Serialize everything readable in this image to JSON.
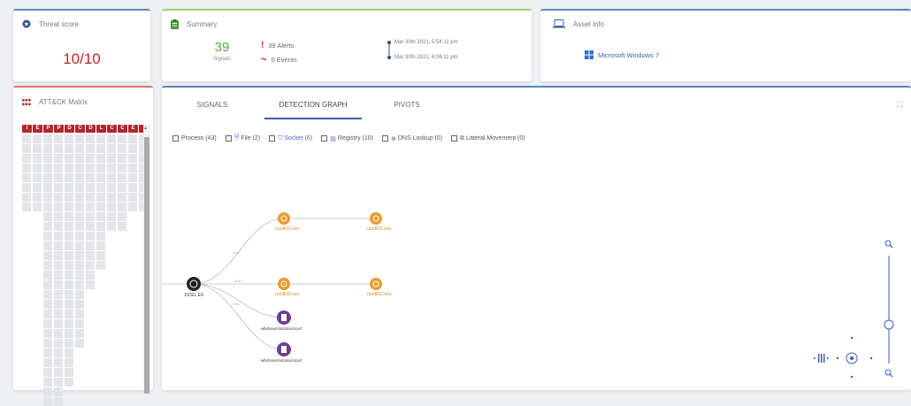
{
  "threat": {
    "title": "Threat score",
    "value": "10/10"
  },
  "summary": {
    "title": "Summary",
    "signals_count": "39",
    "signals_label": "Signals",
    "alerts": "39 Alerts",
    "events": "0 Events",
    "time_start": "Mar 30th 2021, 5:54:11 pm",
    "time_end": "Mar 30th 2021, 6:06:11 pm"
  },
  "asset": {
    "title": "Asset info",
    "os": "Microsoft Windows 7"
  },
  "attack": {
    "title": "ATT&CK Matrix",
    "tactics": [
      "I",
      "E",
      "P",
      "P",
      "D",
      "C",
      "D",
      "L",
      "C",
      "C",
      "E",
      "I"
    ]
  },
  "tabs": [
    "SIGNALS",
    "DETECTION GRAPH",
    "PIVOTS"
  ],
  "filters": [
    {
      "label": "Process (43)"
    },
    {
      "label": "File (2)"
    },
    {
      "label": "Socket (6)"
    },
    {
      "label": "Registry (10)"
    },
    {
      "label": "DNS Lookup (0)"
    },
    {
      "label": "Lateral Movement (0)"
    }
  ],
  "graph": {
    "root_label": "DCEL.EX",
    "node_label_orange": "rundll32.exe",
    "node_label_purple_1": "wfw\\Users\\dc\\docs\\curl",
    "node_label_purple_2": "wfw\\Users\\dc\\docs\\curl",
    "edge_label": "2ms"
  },
  "colors": {
    "threat_accent": "#c8202a",
    "summary_accent": "#9ccf7a",
    "info_accent": "#5b86b9",
    "matrix_accent": "#e06f6f",
    "node_orange": "#e89c2e",
    "node_black": "#222222",
    "node_purple": "#6b3f8e"
  }
}
